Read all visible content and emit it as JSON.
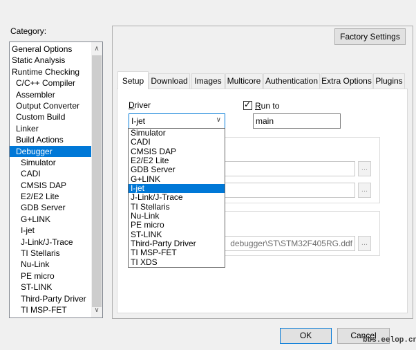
{
  "category": {
    "label": "Category:",
    "items": [
      {
        "label": "General Options",
        "level": 0
      },
      {
        "label": "Static Analysis",
        "level": 0
      },
      {
        "label": "Runtime Checking",
        "level": 0
      },
      {
        "label": "C/C++ Compiler",
        "level": 1
      },
      {
        "label": "Assembler",
        "level": 1
      },
      {
        "label": "Output Converter",
        "level": 1
      },
      {
        "label": "Custom Build",
        "level": 1
      },
      {
        "label": "Linker",
        "level": 1
      },
      {
        "label": "Build Actions",
        "level": 1
      },
      {
        "label": "Debugger",
        "level": 1,
        "selected": true
      },
      {
        "label": "Simulator",
        "level": 2
      },
      {
        "label": "CADI",
        "level": 2
      },
      {
        "label": "CMSIS DAP",
        "level": 2
      },
      {
        "label": "E2/E2 Lite",
        "level": 2
      },
      {
        "label": "GDB Server",
        "level": 2
      },
      {
        "label": "G+LINK",
        "level": 2
      },
      {
        "label": "I-jet",
        "level": 2
      },
      {
        "label": "J-Link/J-Trace",
        "level": 2
      },
      {
        "label": "TI Stellaris",
        "level": 2
      },
      {
        "label": "Nu-Link",
        "level": 2
      },
      {
        "label": "PE micro",
        "level": 2
      },
      {
        "label": "ST-LINK",
        "level": 2
      },
      {
        "label": "Third-Party Driver",
        "level": 2
      },
      {
        "label": "TI MSP-FET",
        "level": 2
      }
    ]
  },
  "factory_settings_label": "Factory Settings",
  "tabs": [
    {
      "label": "Setup",
      "active": true
    },
    {
      "label": "Download"
    },
    {
      "label": "Images"
    },
    {
      "label": "Multicore"
    },
    {
      "label": "Authentication"
    },
    {
      "label": "Extra Options"
    },
    {
      "label": "Plugins"
    }
  ],
  "driver": {
    "label_first": "D",
    "label_rest": "river",
    "selected": "I-jet",
    "options": [
      "Simulator",
      "CADI",
      "CMSIS DAP",
      "E2/E2 Lite",
      "GDB Server",
      "G+LINK",
      "I-jet",
      "J-Link/J-Trace",
      "TI Stellaris",
      "Nu-Link",
      "PE micro",
      "ST-LINK",
      "Third-Party Driver",
      "TI MSP-FET",
      "TI XDS"
    ]
  },
  "run_to": {
    "checked": true,
    "label_first": "R",
    "label_rest": "un to",
    "value": "main"
  },
  "device_description_file": "debugger\\ST\\STM32F405RG.ddf",
  "browse_label": "...",
  "ok_label": "OK",
  "cancel": {
    "label_pre": "Canc",
    "label_u": "e",
    "label_post": "l"
  },
  "watermark": "bbs.eelop.cn",
  "colors": {
    "selection": "#0078d7"
  }
}
